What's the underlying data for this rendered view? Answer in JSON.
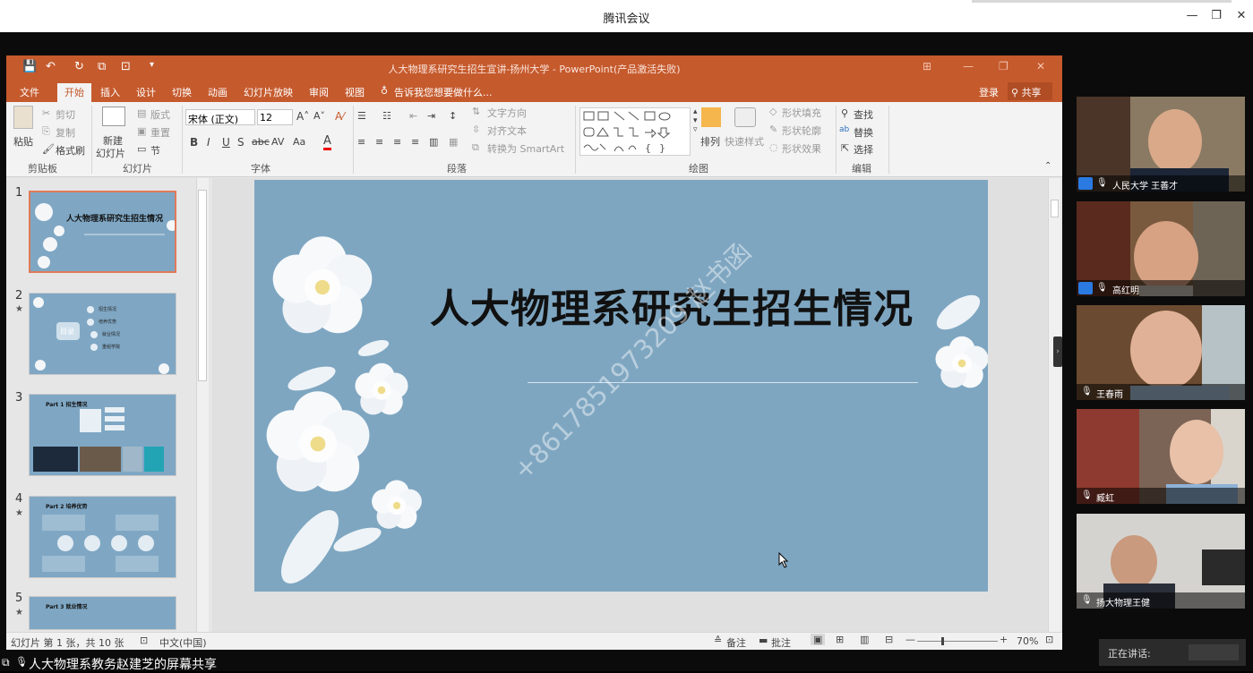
{
  "meeting": {
    "app_title": "腾讯会议",
    "share_text": "人大物理系教务赵建芝的屏幕共享",
    "speaking_label": "正在讲话:"
  },
  "ppt": {
    "window_title": "人大物理系研究生招生宣讲-扬州大学 - PowerPoint(产品激活失败)",
    "tabs": [
      "文件",
      "开始",
      "插入",
      "设计",
      "切换",
      "动画",
      "幻灯片放映",
      "审阅",
      "视图"
    ],
    "tell_me": "告诉我您想要做什么...",
    "login": "登录",
    "share": "共享",
    "ribbon": {
      "paste": "粘贴",
      "cut": "剪切",
      "copy": "复制",
      "format_painter": "格式刷",
      "clipboard_label": "剪贴板",
      "new_slide_1": "新建",
      "new_slide_2": "幻灯片",
      "layout": "版式",
      "reset": "重置",
      "section": "节",
      "slides_label": "幻灯片",
      "font_name": "宋体 (正文)",
      "font_size": "12",
      "font_label": "字体",
      "text_direction": "文字方向",
      "align_text": "对齐文本",
      "smartart": "转换为 SmartArt",
      "paragraph_label": "段落",
      "arrange": "排列",
      "quick_styles": "快速样式",
      "shape_fill": "形状填充",
      "shape_outline": "形状轮廓",
      "shape_effects": "形状效果",
      "drawing_label": "绘图",
      "find": "查找",
      "replace": "替换",
      "select": "选择",
      "editing_label": "编辑"
    },
    "thumbnails": [
      {
        "num": "1",
        "title": "人大物理系研究生招生情况"
      },
      {
        "num": "2",
        "star": "★",
        "title": "目录",
        "items": [
          "招生情况",
          "培养优势",
          "就业情况",
          "重组学院"
        ]
      },
      {
        "num": "3",
        "title": "Part 1 招生情况"
      },
      {
        "num": "4",
        "star": "★",
        "title": "Part 2 培养优势"
      },
      {
        "num": "5",
        "star": "★",
        "title": "Part 3 就业情况"
      }
    ],
    "slide": {
      "title": "人大物理系研究生招生情况",
      "watermark": "+8617851973209 赵书函"
    },
    "status": {
      "slide_info": "幻灯片 第 1 张，共 10 张",
      "language": "中文(中国)",
      "notes": "备注",
      "comments": "批注",
      "zoom": "70%"
    }
  },
  "participants": [
    {
      "name": "人民大学 王善才"
    },
    {
      "name": "高红明"
    },
    {
      "name": "王春雨"
    },
    {
      "name": "臧虹"
    },
    {
      "name": "扬大物理王健"
    }
  ],
  "colors": {
    "ppt_orange": "#c55a2d",
    "slide_bg": "#7ea6c1"
  }
}
